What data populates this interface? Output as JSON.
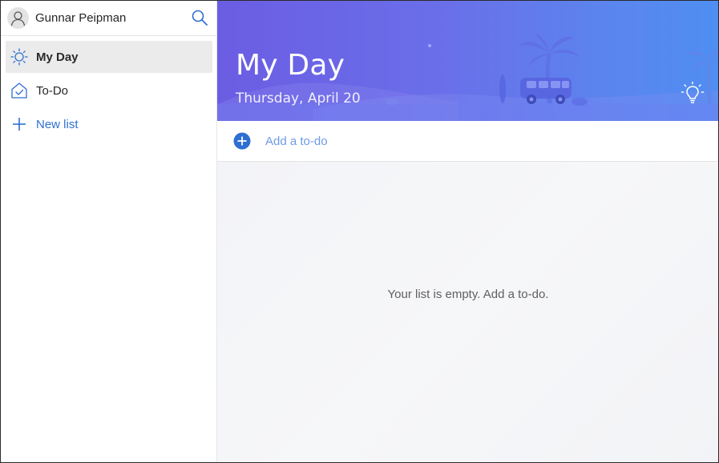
{
  "user": {
    "name": "Gunnar Peipman"
  },
  "sidebar": {
    "items": [
      {
        "label": "My Day",
        "icon": "sun-icon",
        "active": true
      },
      {
        "label": "To-Do",
        "icon": "home-check-icon",
        "active": false
      },
      {
        "label": "New list",
        "icon": "plus-icon",
        "active": false
      }
    ]
  },
  "header": {
    "title": "My Day",
    "date": "Thursday, April 20"
  },
  "add_task": {
    "placeholder": "Add a to-do"
  },
  "list": {
    "empty_message": "Your list is empty. Add a to-do."
  },
  "colors": {
    "accent": "#2f6fd1",
    "hero_start": "#6b5de3",
    "hero_end": "#4f8ef2"
  }
}
